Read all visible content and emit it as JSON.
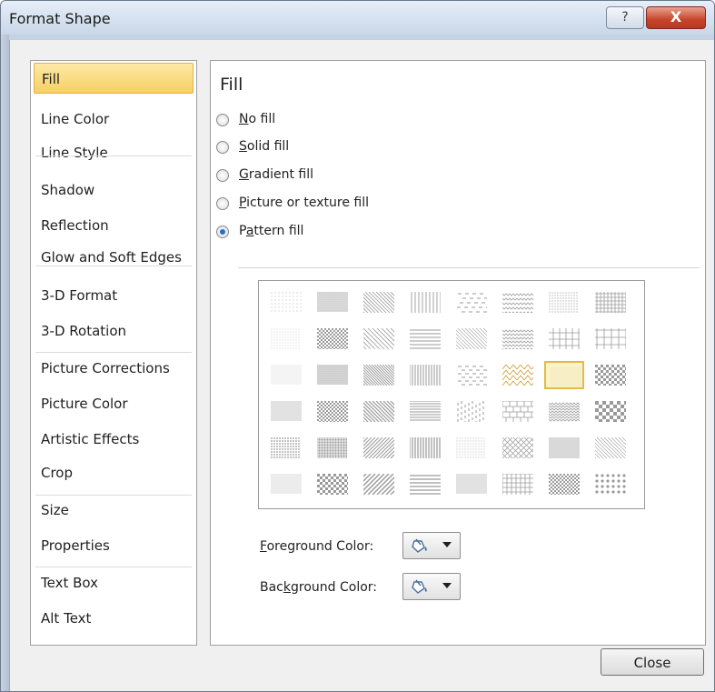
{
  "window": {
    "title": "Format Shape",
    "help_glyph": "?",
    "close_glyph": "X"
  },
  "nav": {
    "items": [
      {
        "label": "Fill",
        "selected": true
      },
      {
        "label": "Line Color"
      },
      {
        "label": "Line Style"
      },
      {
        "label": "Shadow"
      },
      {
        "label": "Reflection"
      },
      {
        "label": "Glow and Soft Edges"
      },
      {
        "label": "3-D Format"
      },
      {
        "label": "3-D Rotation"
      },
      {
        "label": "Picture Corrections"
      },
      {
        "label": "Picture Color"
      },
      {
        "label": "Artistic Effects"
      },
      {
        "label": "Crop"
      },
      {
        "label": "Size"
      },
      {
        "label": "Properties"
      },
      {
        "label": "Text Box"
      },
      {
        "label": "Alt Text"
      }
    ]
  },
  "fill": {
    "heading": "Fill",
    "options": [
      {
        "label": "No fill",
        "accel": "N",
        "checked": false
      },
      {
        "label": "Solid fill",
        "accel": "S",
        "checked": false
      },
      {
        "label": "Gradient fill",
        "accel": "G",
        "checked": false
      },
      {
        "label": "Picture or texture fill",
        "accel": "P",
        "checked": false
      },
      {
        "label": "Pattern fill",
        "accel": "a",
        "checked": true
      }
    ],
    "pattern_grid": {
      "rows": 6,
      "cols": 8,
      "selected_row": 2,
      "selected_col": 6
    },
    "foreground_label": "Foreground Color:",
    "background_label": "Background Color:",
    "foreground_icon": "paint-bucket-icon",
    "background_icon": "paint-bucket-icon"
  },
  "footer": {
    "close_label": "Close"
  },
  "colors": {
    "accent": "#2a6fc9",
    "selected_nav": "#f7cf64",
    "pattern_ink": "#9a9a9a"
  }
}
